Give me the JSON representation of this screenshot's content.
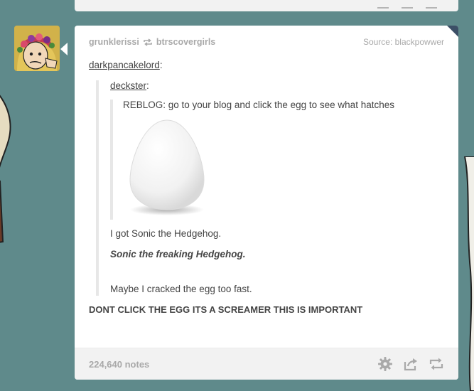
{
  "post": {
    "reblogger": "grunklerissi",
    "reblogged_from": "btrscovergirls",
    "source_label": "Source: blackpowwer",
    "level1_user": "darkpancakelord",
    "level2_user": "deckster",
    "level3_text": "REBLOG: go to your blog and click the egg to see what hatches",
    "level2_line1": "I got Sonic the Hedgehog.",
    "level2_line2": "Sonic the freaking Hedgehog.",
    "level2_line3": "Maybe I cracked the egg too fast.",
    "level1_text": "DONT CLICK THE EGG ITS A SCREAMER THIS IS IMPORTANT",
    "notes": "224,640 notes",
    "colon": ":"
  },
  "icons": {
    "reblog_small": "reblog-icon",
    "settings": "gear-icon",
    "share": "share-icon",
    "reblog": "reblog-icon"
  },
  "colors": {
    "background": "#5f8a8b",
    "corner": "#3c4f66"
  }
}
